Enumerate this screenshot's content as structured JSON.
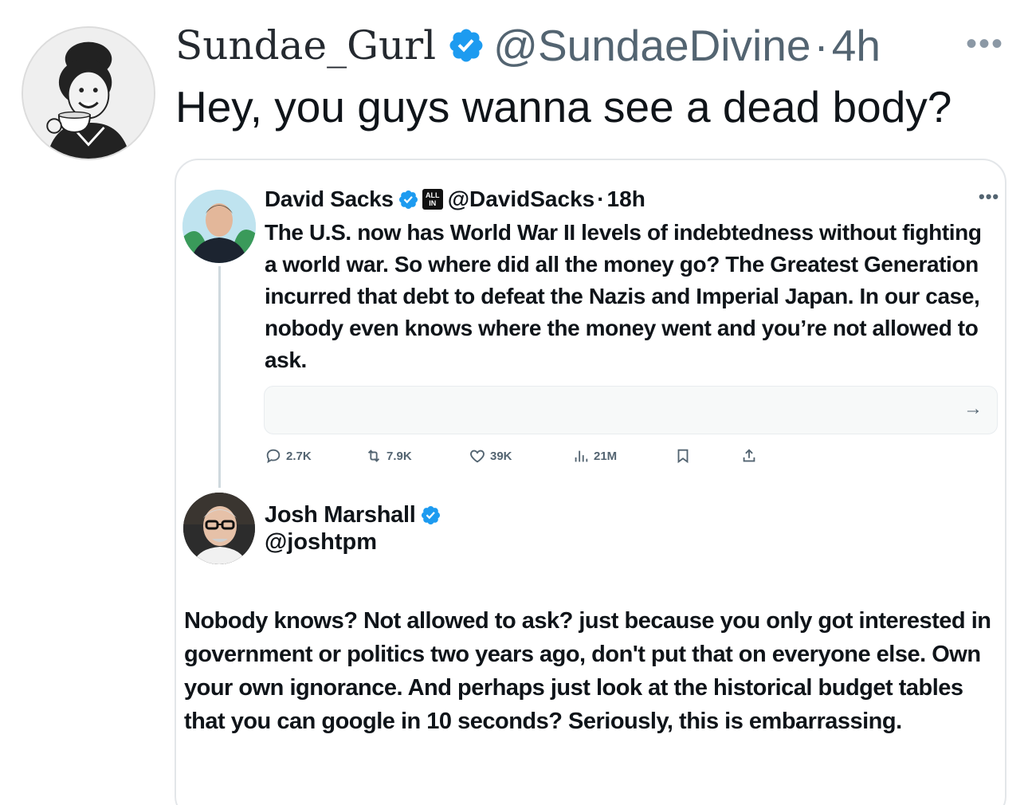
{
  "post": {
    "display_name": "Sundae_Gurl",
    "handle": "@SundaeDivine",
    "separator": "·",
    "time": "4h",
    "more": "•••",
    "text": "Hey, you guys wanna see a dead body?"
  },
  "quoted_tweet": {
    "display_name": "David Sacks",
    "badge_text_top": "ALL",
    "badge_text_bottom": "IN",
    "handle": "@DavidSacks",
    "separator": "·",
    "time": "18h",
    "more": "•••",
    "text": "The U.S. now has World War II levels of indebtedness without fighting a world war. So where did all the money go? The Greatest Generation incurred that debt to defeat the Nazis and Imperial Japan. In our case, nobody even knows where the money went and you’re not allowed to ask.",
    "link_arrow": "→",
    "stats": {
      "replies": "2.7K",
      "retweets": "7.9K",
      "likes": "39K",
      "views": "21M"
    }
  },
  "reply": {
    "display_name": "Josh Marshall",
    "handle": "@joshtpm",
    "text": "Nobody knows? Not allowed to ask? just because you only got interested in government or politics two years ago, don't put that on everyone else. Own your own ignorance. And perhaps just look at the historical budget tables that you can google in 10 seconds? Seriously, this is embarrassing."
  },
  "colors": {
    "verified": "#1d9bf0",
    "text_primary": "#0f1419",
    "text_secondary": "#536471",
    "border": "#e3e6e9"
  }
}
